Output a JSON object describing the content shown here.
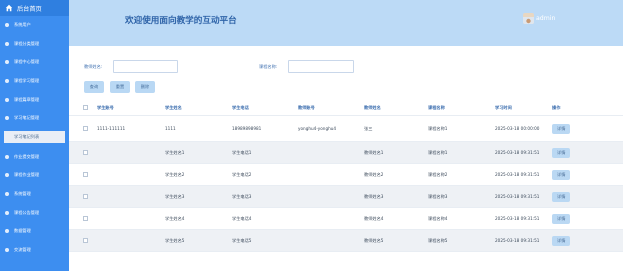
{
  "sidebar": {
    "title": "后台首页",
    "items": [
      {
        "label": "系统用户",
        "icon": "user-icon"
      },
      {
        "label": "课程分类管理",
        "icon": "category-icon"
      },
      {
        "label": "课程中心管理",
        "icon": "course-icon"
      },
      {
        "label": "课程学习管理",
        "icon": "study-icon"
      },
      {
        "label": "课程篇章管理",
        "icon": "chapter-icon"
      },
      {
        "label": "学习笔记管理",
        "icon": "note-icon"
      },
      {
        "label": "作业提交管理",
        "icon": "homework-icon"
      },
      {
        "label": "课程作业管理",
        "icon": "assignment-icon"
      },
      {
        "label": "系统管理",
        "icon": "settings-icon"
      },
      {
        "label": "课程公告管理",
        "icon": "notice-icon"
      },
      {
        "label": "数据管理",
        "icon": "data-icon"
      },
      {
        "label": "交流管理",
        "icon": "chat-icon"
      }
    ],
    "submenu_label": "学习笔记列表"
  },
  "header": {
    "title": "欢迎使用面向教学的互动平台",
    "username": "admin"
  },
  "search": {
    "label1": "教师姓名:",
    "label2": "课程名称:",
    "placeholder1": "",
    "placeholder2": ""
  },
  "toolbar": {
    "query": "查询",
    "reset": "重置",
    "delete": "删除"
  },
  "table": {
    "columns": [
      "学生账号",
      "学生姓名",
      "学生电话",
      "教师账号",
      "教师姓名",
      "课程名称",
      "学习时间",
      "操作"
    ],
    "rows": [
      [
        "1111-111111",
        "1111",
        "18989898981",
        "yonghu4-yonghu4",
        "张三",
        "课程名称1",
        "2025-03-18 00:00:00",
        "详情"
      ],
      [
        "",
        "学生姓名1",
        "学生电话1",
        "",
        "教师姓名1",
        "课程名称1",
        "2025-03-18 09:31:51",
        "详情"
      ],
      [
        "",
        "学生姓名2",
        "学生电话2",
        "",
        "教师姓名2",
        "课程名称2",
        "2025-03-18 09:31:51",
        "详情"
      ],
      [
        "",
        "学生姓名3",
        "学生电话3",
        "",
        "教师姓名3",
        "课程名称3",
        "2025-03-18 09:31:51",
        "详情"
      ],
      [
        "",
        "学生姓名4",
        "学生电话4",
        "",
        "教师姓名4",
        "课程名称4",
        "2025-03-18 09:31:51",
        "详情"
      ],
      [
        "",
        "学生姓名5",
        "学生电话5",
        "",
        "教师姓名5",
        "课程名称5",
        "2025-03-18 09:31:51",
        "详情"
      ]
    ]
  }
}
